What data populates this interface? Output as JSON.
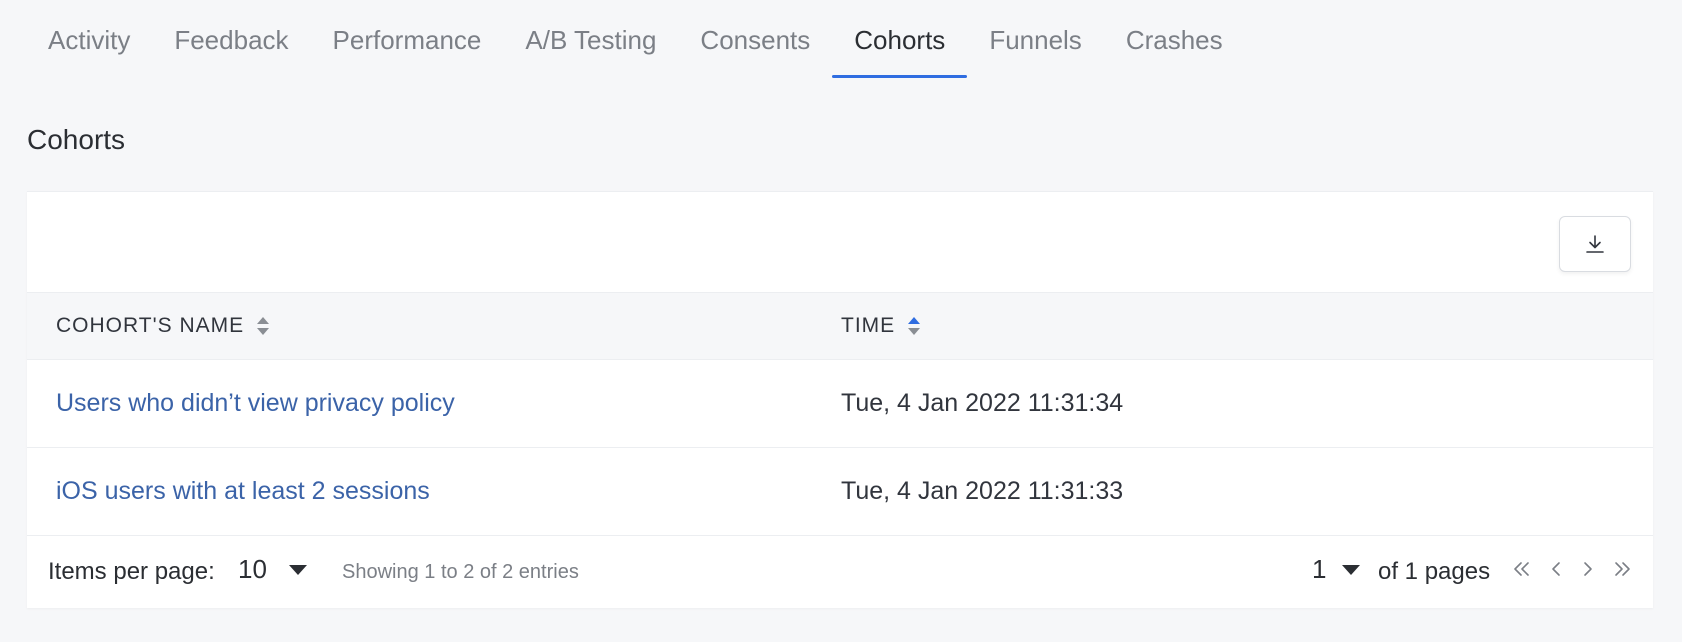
{
  "tabs": [
    {
      "label": "Activity",
      "active": false
    },
    {
      "label": "Feedback",
      "active": false
    },
    {
      "label": "Performance",
      "active": false
    },
    {
      "label": "A/B Testing",
      "active": false
    },
    {
      "label": "Consents",
      "active": false
    },
    {
      "label": "Cohorts",
      "active": true
    },
    {
      "label": "Funnels",
      "active": false
    },
    {
      "label": "Crashes",
      "active": false
    }
  ],
  "page": {
    "title": "Cohorts"
  },
  "toolbar": {
    "download_icon": "download-icon"
  },
  "table": {
    "columns": [
      {
        "label": "COHORT'S NAME",
        "sort_icon": "sort-icon",
        "sort_active": false
      },
      {
        "label": "TIME",
        "sort_icon": "sort-icon",
        "sort_active": true
      }
    ],
    "rows": [
      {
        "name": "Users who didn’t view privacy policy",
        "time": "Tue, 4 Jan 2022 11:31:34"
      },
      {
        "name": "iOS users with at least 2 sessions",
        "time": "Tue, 4 Jan 2022 11:31:33"
      }
    ]
  },
  "pagination": {
    "items_per_page_label": "Items per page:",
    "items_per_page_value": "10",
    "showing_text": "Showing 1 to 2 of 2 entries",
    "current_page": "1",
    "of_pages_text": "of 1 pages",
    "icons": [
      "first-page-icon",
      "prev-page-icon",
      "next-page-icon",
      "last-page-icon"
    ]
  },
  "colors": {
    "accent": "#2f6de1",
    "link": "#3b63a8",
    "sort_inactive": "#8a8e94"
  }
}
